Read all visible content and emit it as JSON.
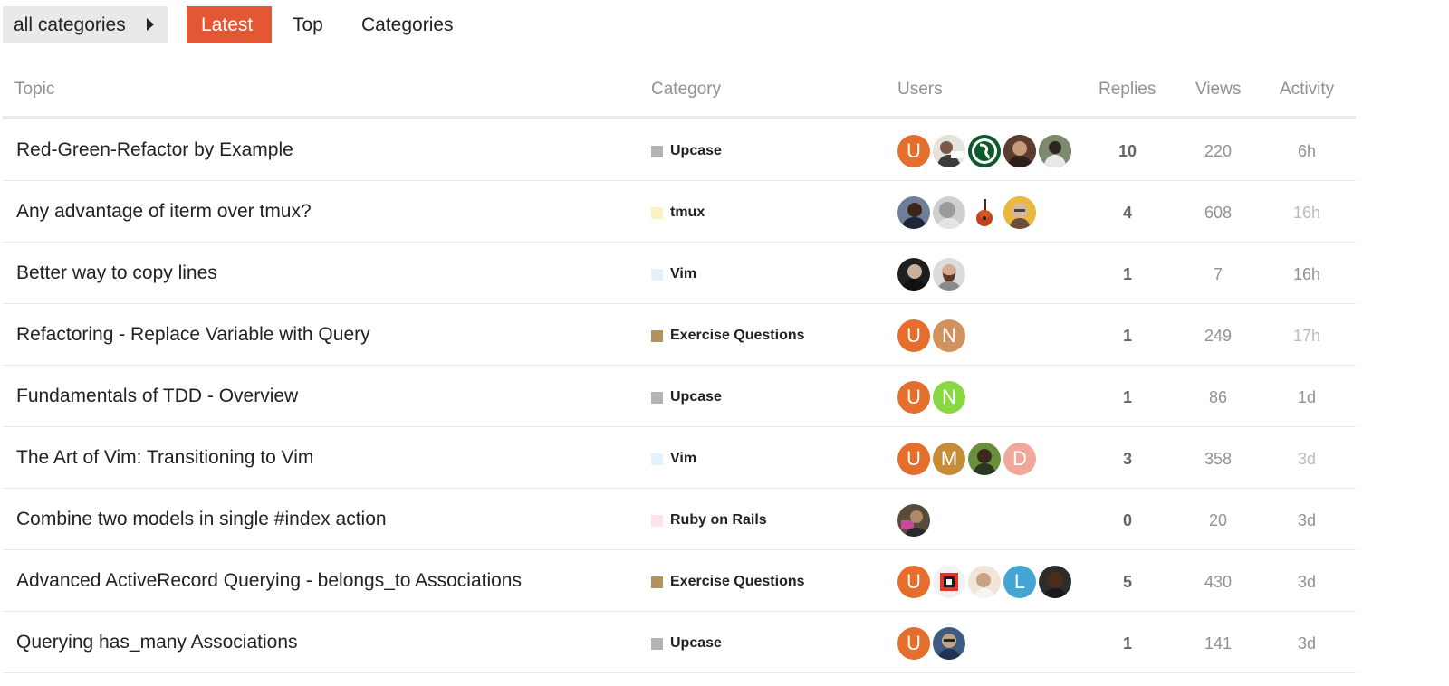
{
  "nav": {
    "category_dropdown": "all categories",
    "tabs": [
      "Latest",
      "Top",
      "Categories"
    ]
  },
  "table": {
    "headers": {
      "topic": "Topic",
      "category": "Category",
      "users": "Users",
      "replies": "Replies",
      "views": "Views",
      "activity": "Activity"
    },
    "rows": [
      {
        "title": "Red-Green-Refactor by Example",
        "category": "Upcase",
        "replies": "10",
        "views": "220",
        "activity": "6h"
      },
      {
        "title": "Any advantage of iterm over tmux?",
        "category": "tmux",
        "replies": "4",
        "views": "608",
        "activity": "16h"
      },
      {
        "title": "Better way to copy lines",
        "category": "Vim",
        "replies": "1",
        "views": "7",
        "activity": "16h"
      },
      {
        "title": "Refactoring - Replace Variable with Query",
        "category": "Exercise Questions",
        "replies": "1",
        "views": "249",
        "activity": "17h"
      },
      {
        "title": "Fundamentals of TDD - Overview",
        "category": "Upcase",
        "replies": "1",
        "views": "86",
        "activity": "1d"
      },
      {
        "title": "The Art of Vim: Transitioning to Vim",
        "category": "Vim",
        "replies": "3",
        "views": "358",
        "activity": "3d"
      },
      {
        "title": "Combine two models in single #index action",
        "category": "Ruby on Rails",
        "replies": "0",
        "views": "20",
        "activity": "3d"
      },
      {
        "title": "Advanced ActiveRecord Querying - belongs_to Associations",
        "category": "Exercise Questions",
        "replies": "5",
        "views": "430",
        "activity": "3d"
      },
      {
        "title": "Querying has_many Associations",
        "category": "Upcase",
        "replies": "1",
        "views": "141",
        "activity": "3d"
      }
    ]
  },
  "colors": {
    "accent": "#e45735",
    "category_upcase": "#b3b3b3",
    "category_tmux": "#fbf2c0",
    "category_vim": "#e2f2fc",
    "category_exercise": "#b3925f",
    "category_rails": "#fce4e9"
  },
  "avatars": [
    [
      {
        "letter": "U",
        "color": "#e66e2c"
      },
      {
        "icon": "user-photo-icon"
      },
      {
        "icon": "brewery-logo-icon"
      },
      {
        "icon": "user-photo-icon"
      },
      {
        "icon": "user-photo-icon"
      }
    ],
    [
      {
        "icon": "user-photo-icon"
      },
      {
        "icon": "user-photo-icon"
      },
      {
        "icon": "guitar-icon"
      },
      {
        "icon": "user-photo-icon"
      }
    ],
    [
      {
        "icon": "user-photo-icon"
      },
      {
        "icon": "user-photo-icon"
      }
    ],
    [
      {
        "letter": "U",
        "color": "#e66e2c"
      },
      {
        "letter": "N",
        "color": "#d1925e"
      }
    ],
    [
      {
        "letter": "U",
        "color": "#e66e2c"
      },
      {
        "letter": "N",
        "color": "#8ad744"
      }
    ],
    [
      {
        "letter": "U",
        "color": "#e66e2c"
      },
      {
        "letter": "M",
        "color": "#c68c36"
      },
      {
        "icon": "user-photo-icon"
      },
      {
        "letter": "D",
        "color": "#f0a89a"
      }
    ],
    [
      {
        "icon": "user-photo-icon"
      }
    ],
    [
      {
        "letter": "U",
        "color": "#e66e2c"
      },
      {
        "icon": "upcase-logo-icon"
      },
      {
        "icon": "user-photo-icon"
      },
      {
        "letter": "L",
        "color": "#42a5d4"
      },
      {
        "icon": "user-photo-icon"
      }
    ],
    [
      {
        "letter": "U",
        "color": "#e66e2c"
      },
      {
        "icon": "user-photo-icon"
      }
    ]
  ]
}
